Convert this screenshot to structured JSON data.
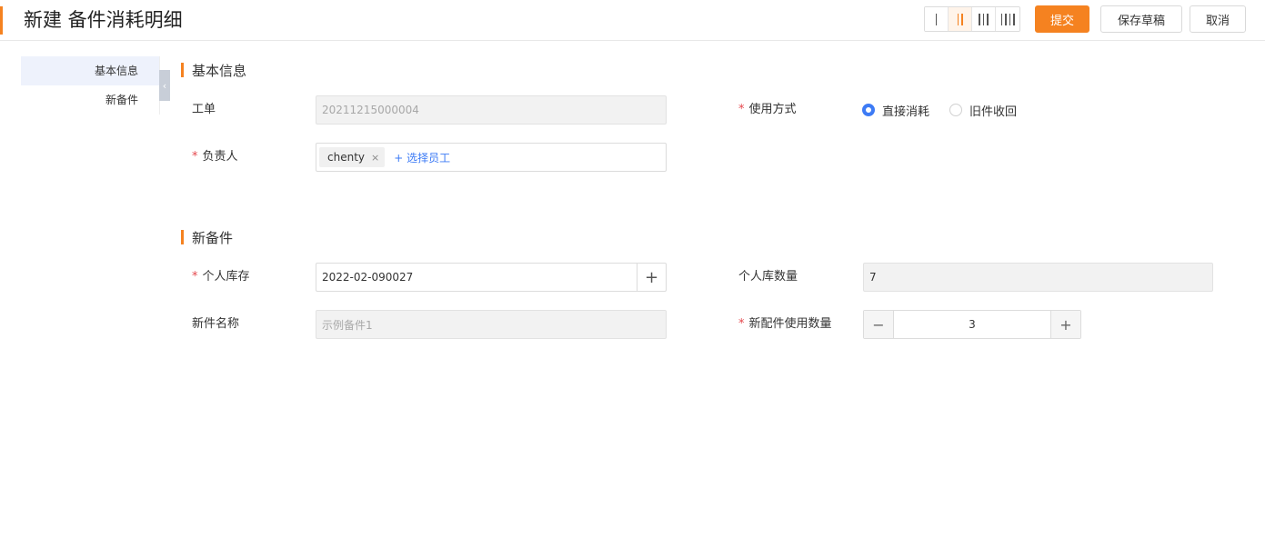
{
  "header": {
    "title": "新建 备件消耗明细",
    "submit_label": "提交",
    "save_draft_label": "保存草稿",
    "cancel_label": "取消",
    "column_layout_options": [
      1,
      2,
      3,
      4
    ],
    "column_layout_selected": 2
  },
  "sidenav": {
    "items": [
      {
        "label": "基本信息",
        "active": true
      },
      {
        "label": "新备件",
        "active": false
      }
    ]
  },
  "basic": {
    "section_title": "基本信息",
    "work_order_label": "工单",
    "work_order_value": "20211215000004",
    "usage_mode_label": "使用方式",
    "usage_options": [
      {
        "label": "直接消耗",
        "checked": true
      },
      {
        "label": "旧件收回",
        "checked": false
      }
    ],
    "owner_label": "负责人",
    "owner_tag": "chenty",
    "owner_add_label": "+ 选择员工"
  },
  "new_part": {
    "section_title": "新备件",
    "personal_stock_label": "个人库存",
    "personal_stock_value": "2022-02-090027",
    "personal_qty_label": "个人库数量",
    "personal_qty_value": "7",
    "part_name_label": "新件名称",
    "part_name_value": "示例备件1",
    "use_qty_label": "新配件使用数量",
    "use_qty_value": "3"
  },
  "colors": {
    "accent": "#f58220",
    "primary_blue": "#3d7bf5",
    "required": "#e5484d"
  }
}
